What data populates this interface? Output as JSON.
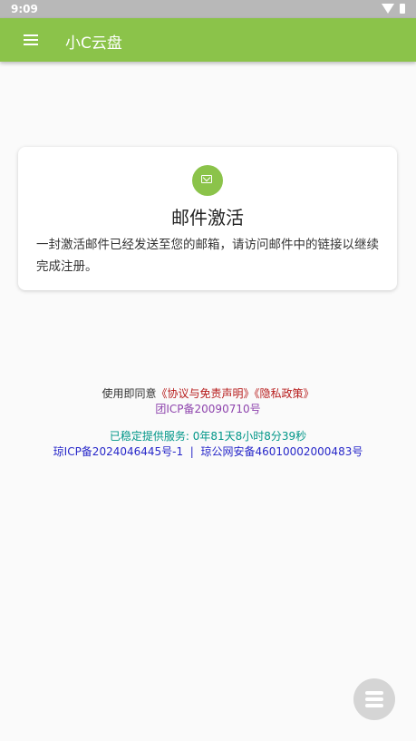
{
  "status_bar": {
    "time": "9:09"
  },
  "app_bar": {
    "title": "小C云盘"
  },
  "card": {
    "icon": "mail-icon",
    "title": "邮件激活",
    "message": "一封激活邮件已经发送至您的邮箱，请访问邮件中的链接以继续完成注册。"
  },
  "footer": {
    "agree_prefix": "使用即同意",
    "agreement_link": "《协议与免责声明》",
    "privacy_link": "《隐私政策》",
    "icp_group": "团ICP备20090710号",
    "uptime": "已稳定提供服务: 0年81天8小时8分39秒",
    "icp_qiong": "琼ICP备2024046445号-1",
    "separator": "|",
    "police": "琼公网安备46010002000483号"
  },
  "colors": {
    "primary": "#8bc34a",
    "link_red": "#b71c1c",
    "purple": "#8e44ad",
    "teal": "#009688",
    "blue": "#2727c9"
  }
}
